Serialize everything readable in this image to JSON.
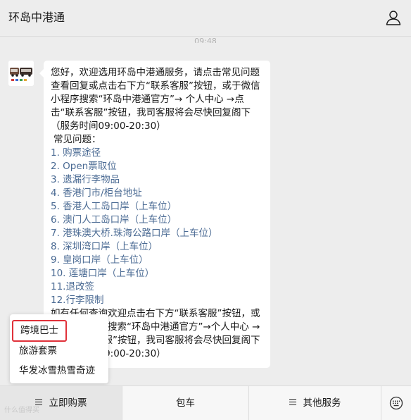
{
  "header": {
    "title": "环岛中港通",
    "user_icon": "user-icon"
  },
  "chat": {
    "timestamp": "09:48",
    "message": {
      "intro": "您好，欢迎选用环岛中港通服务，请点击常见问题查看回复或点击右下方“联系客服”按钮，或于微信小程序搜索“环岛中港通官方”→ 个人中心 →点击“联系客服”按钮，我司客服将会尽快回复阁下（服务时间09:00-20:30）",
      "faq_heading": "常见问题：",
      "faq": [
        "1. 购票途径",
        "2. Open票取位",
        "3. 遗漏行李物品",
        "4. 香港门市/柜台地址",
        "5. 香港人工岛口岸（上车位）",
        "6. 澳门人工岛口岸（上车位）",
        "7. 港珠澳大桥.珠海公路口岸（上车位）",
        "8. 深圳湾口岸（上车位）",
        "9. 皇岗口岸（上车位）",
        "10. 莲塘口岸（上车位）",
        "11.退改签",
        "12.行李限制"
      ],
      "outro": "如有任何查询欢迎点击右下方“联系客服”按钮，或于微信小程序搜索“环岛中港通官方”→个人中心 →点击“联系客服”按钮，我司客服将会尽快回复阁下（服务时间09:00-20:30）"
    }
  },
  "popup_menu": {
    "items": [
      "跨境巴士",
      "旅游套票",
      "华发冰雪热雪奇迹"
    ],
    "highlighted_index": 0,
    "highlight_color": "#e0313a"
  },
  "bottom_menu": {
    "tabs": [
      "立即购票",
      "包车",
      "其他服务"
    ],
    "active_index": 0,
    "menu_icon": "hamburger-icon",
    "keyboard_icon": "emoji-keyboard-icon"
  },
  "watermark": "什么值得买"
}
